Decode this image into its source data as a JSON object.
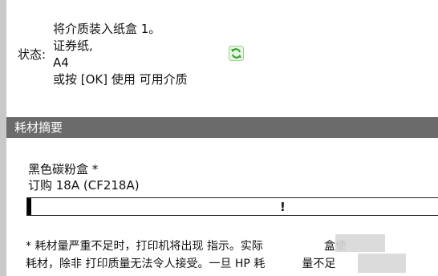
{
  "status": {
    "label": "状态:",
    "lines": [
      "将介质装入纸盒 1。",
      "证券纸,",
      "A4",
      "或按 [OK] 使用 可用介质"
    ],
    "refresh_icon": "refresh-icon"
  },
  "supplies": {
    "section_title": "耗材摘要",
    "item_name": "黑色碳粉盒 *",
    "order_text": "订购 18A (CF218A)",
    "level_percent": 1,
    "warning_mark": "!"
  },
  "footnote": {
    "line1": "* 耗材量严重不足时，打印机将出现 指示。实际",
    "line1_tail": "盒使",
    "line2": "耗材，除非 打印质量无法令人接受。一旦 HP 耗",
    "line2_tail": "量不足"
  },
  "colors": {
    "section_bar": "#6b6b6b",
    "refresh_green": "#3aa33a"
  }
}
